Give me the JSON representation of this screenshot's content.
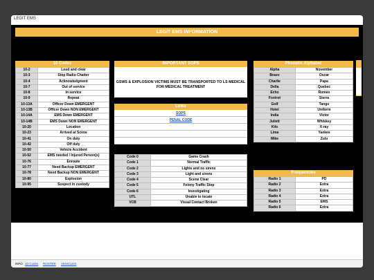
{
  "doc": {
    "title": "LEGIT EMS"
  },
  "banner": "LEGIT EMS INFORMATION",
  "ten_codes": {
    "header": "10 Codes",
    "rows": [
      [
        "10-2",
        "Loud and clear"
      ],
      [
        "10-3",
        "Stop Radio Chatter"
      ],
      [
        "10-4",
        "Acknowledgment"
      ],
      [
        "10-7",
        "Out of service"
      ],
      [
        "10-8",
        "In service"
      ],
      [
        "10-9",
        "Repeat"
      ],
      [
        "10-13A",
        "Officer Down EMERGENT"
      ],
      [
        "10-13B",
        "Officer Down NON EMERGENT"
      ],
      [
        "10-14A",
        "EMS Down EMERGENT"
      ],
      [
        "10-14B",
        "EMS Down NON EMERGENT"
      ],
      [
        "10-20",
        "Location"
      ],
      [
        "10-23",
        "Arrived at Scene"
      ],
      [
        "10-41",
        "On duty"
      ],
      [
        "10-42",
        "Off duty"
      ],
      [
        "10-50",
        "Vehicle Accident"
      ],
      [
        "10-52",
        "EMS needed / Injured Person(s)"
      ],
      [
        "10-76",
        "Enroute"
      ],
      [
        "10-77",
        "Need Backup EMERGENT"
      ],
      [
        "10-78",
        "Need Backup NON EMERGENT"
      ],
      [
        "10-80",
        "Explosion"
      ],
      [
        "10-95",
        "Suspect in custody"
      ]
    ]
  },
  "sops": {
    "header": "IMPORTANT SOPS",
    "note": "GSWS & EXPLOSION VICTIMS MUST BE TRANSPORTED TO LS MEDICAL FOR MEDICAL TREATMENT"
  },
  "links": {
    "header": "Links",
    "items": [
      "SOPS",
      "PENAL CODE"
    ]
  },
  "codes": {
    "rows": [
      [
        "Code 0",
        "Game Crash"
      ],
      [
        "Code 1",
        "Normal Traffic"
      ],
      [
        "Code 2",
        "Lights and no sirens"
      ],
      [
        "Code 3",
        "Light and sirens"
      ],
      [
        "Code 4",
        "Scene Clear"
      ],
      [
        "Code 5",
        "Felony Traffic Stop"
      ],
      [
        "Code 6",
        "Investigating"
      ],
      [
        "UTL",
        "Unable to locate"
      ],
      [
        "VCB",
        "Visual Contact Broken"
      ]
    ]
  },
  "phonetic": {
    "header": "Phonetic Alphabet",
    "rows": [
      [
        "Alpha",
        "November"
      ],
      [
        "Bravo",
        "Oscar"
      ],
      [
        "Charlie",
        "Papa"
      ],
      [
        "Della",
        "Quebec"
      ],
      [
        "Echo",
        "Romeo"
      ],
      [
        "Foxtrot",
        "Sierra"
      ],
      [
        "Golf",
        "Tango"
      ],
      [
        "Hotel",
        "Uniform"
      ],
      [
        "India",
        "Victor"
      ],
      [
        "Juliett",
        "Whiskey"
      ],
      [
        "Kilo",
        "X-ray"
      ],
      [
        "Lima",
        "Yankee"
      ],
      [
        "Mike",
        "Zulu"
      ]
    ]
  },
  "frequencies": {
    "header": "Frequencies",
    "rows": [
      [
        "Radio 1",
        "PD"
      ],
      [
        "Radio 2",
        "Extra"
      ],
      [
        "Radio 3",
        "Extra"
      ],
      [
        "Radio 4",
        "Extra"
      ],
      [
        "Radio 5",
        "EMS"
      ],
      [
        "Radio 6",
        "Extra"
      ]
    ]
  },
  "tabs": [
    "INFO",
    "10 Codes",
    "ROSTER",
    "VEHICLES"
  ],
  "colors": {
    "accent": "#f2b84b",
    "link": "#1155cc",
    "key_cell": "#d9d9d9"
  }
}
